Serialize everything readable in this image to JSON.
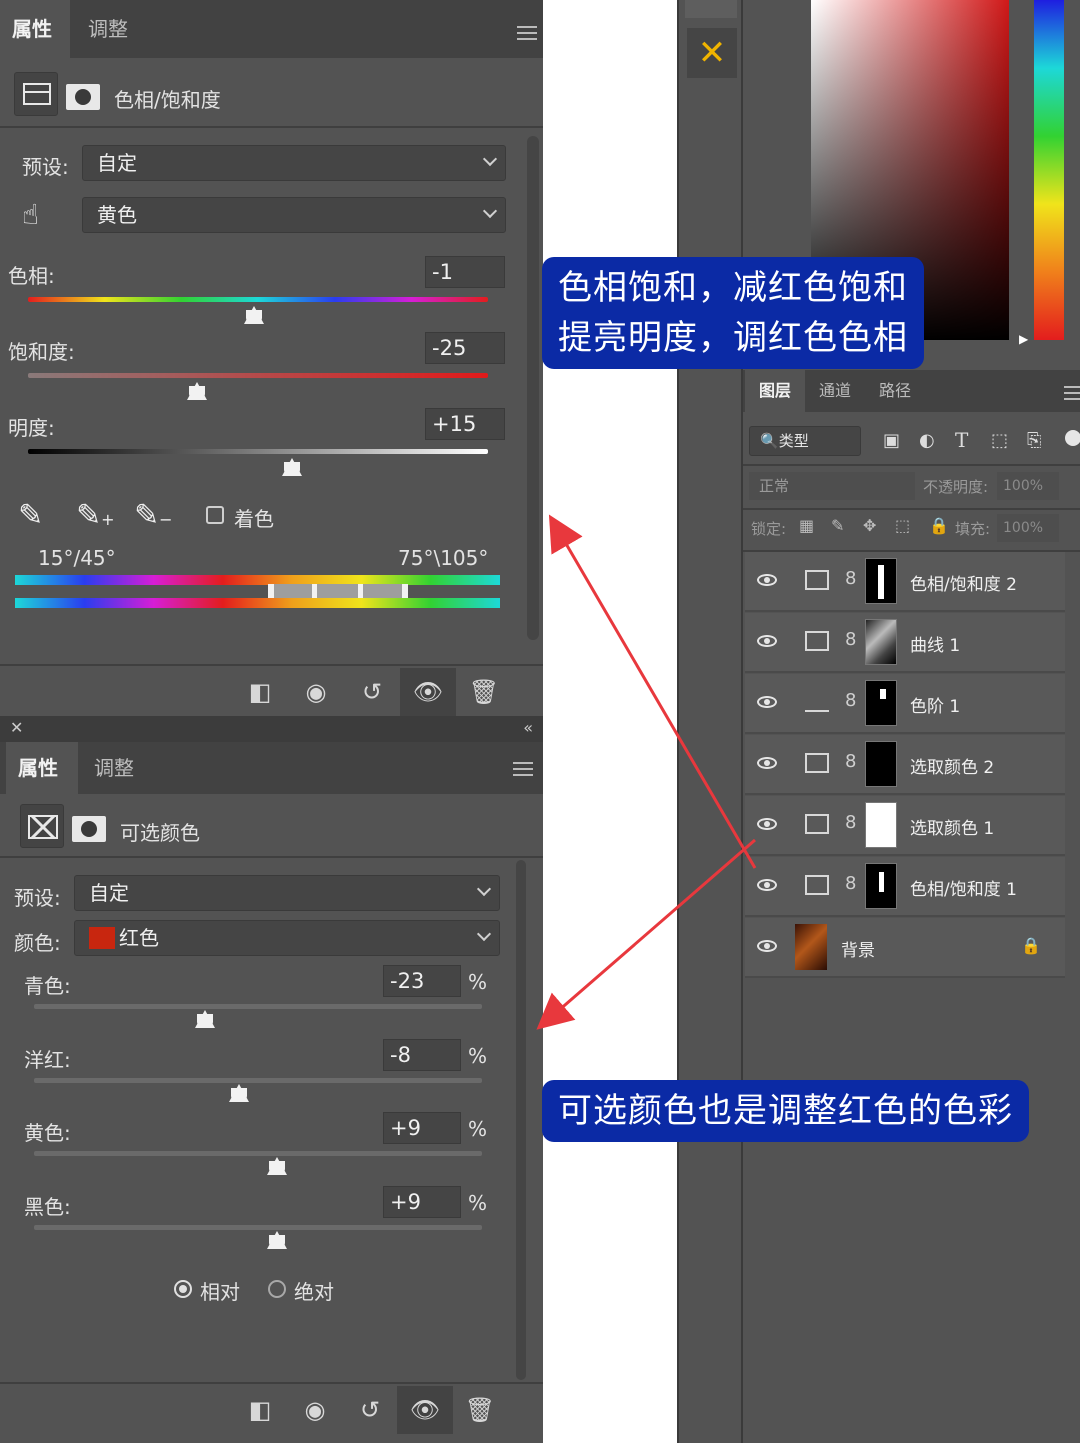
{
  "top_panel": {
    "tabs": [
      "属性",
      "调整"
    ],
    "adjustment_title": "色相/饱和度",
    "preset_label": "预设:",
    "preset_value": "自定",
    "channel_value": "黄色",
    "hue_label": "色相:",
    "hue_value": "-1",
    "hue_level": 0.49,
    "saturation_label": "饱和度:",
    "saturation_value": "-25",
    "saturation_level": 0.37,
    "lightness_label": "明度:",
    "lightness_value": "+15",
    "lightness_level": 0.57,
    "colorize_label": "着色",
    "range_left": "15°/45°",
    "range_right": "75°\\105°"
  },
  "bottom_panel": {
    "tabs": [
      "属性",
      "调整"
    ],
    "adjustment_title": "可选颜色",
    "preset_label": "预设:",
    "preset_value": "自定",
    "color_label": "颜色:",
    "color_value": "红色",
    "color_swatch": "#c8260f",
    "sliders": [
      {
        "label": "青色:",
        "value": "-23",
        "unit": "%",
        "level": 0.38
      },
      {
        "label": "洋红:",
        "value": "-8",
        "unit": "%",
        "level": 0.46
      },
      {
        "label": "黄色:",
        "value": "+9",
        "unit": "%",
        "level": 0.54
      },
      {
        "label": "黑色:",
        "value": "+9",
        "unit": "%",
        "level": 0.54
      }
    ],
    "method_relative": "相对",
    "method_absolute": "绝对"
  },
  "layers_panel": {
    "tabs": [
      "图层",
      "通道",
      "路径"
    ],
    "filter_label": "类型",
    "blend_mode": "正常",
    "opacity_label": "不透明度:",
    "opacity_value": "100%",
    "lock_label": "锁定:",
    "fill_label": "填充:",
    "fill_value": "100%",
    "layers": [
      {
        "name": "色相/饱和度 2",
        "icon": "hue-saturation-icon"
      },
      {
        "name": "曲线 1",
        "icon": "curves-icon"
      },
      {
        "name": "色阶 1",
        "icon": "levels-icon"
      },
      {
        "name": "选取颜色 2",
        "icon": "selective-color-icon"
      },
      {
        "name": "选取颜色 1",
        "icon": "selective-color-icon"
      },
      {
        "name": "色相/饱和度 1",
        "icon": "hue-saturation-icon"
      },
      {
        "name": "背景",
        "icon": "lock-icon"
      }
    ]
  },
  "callouts": {
    "callout1_line1": "色相饱和，减红色饱和",
    "callout1_line2": "提亮明度，调红色色相",
    "callout2": "可选颜色也是调整红色的色彩"
  },
  "colors": {
    "panel_bg": "#535353",
    "callout_bg": "#0b2aa5",
    "arrow": "#e8383d"
  }
}
